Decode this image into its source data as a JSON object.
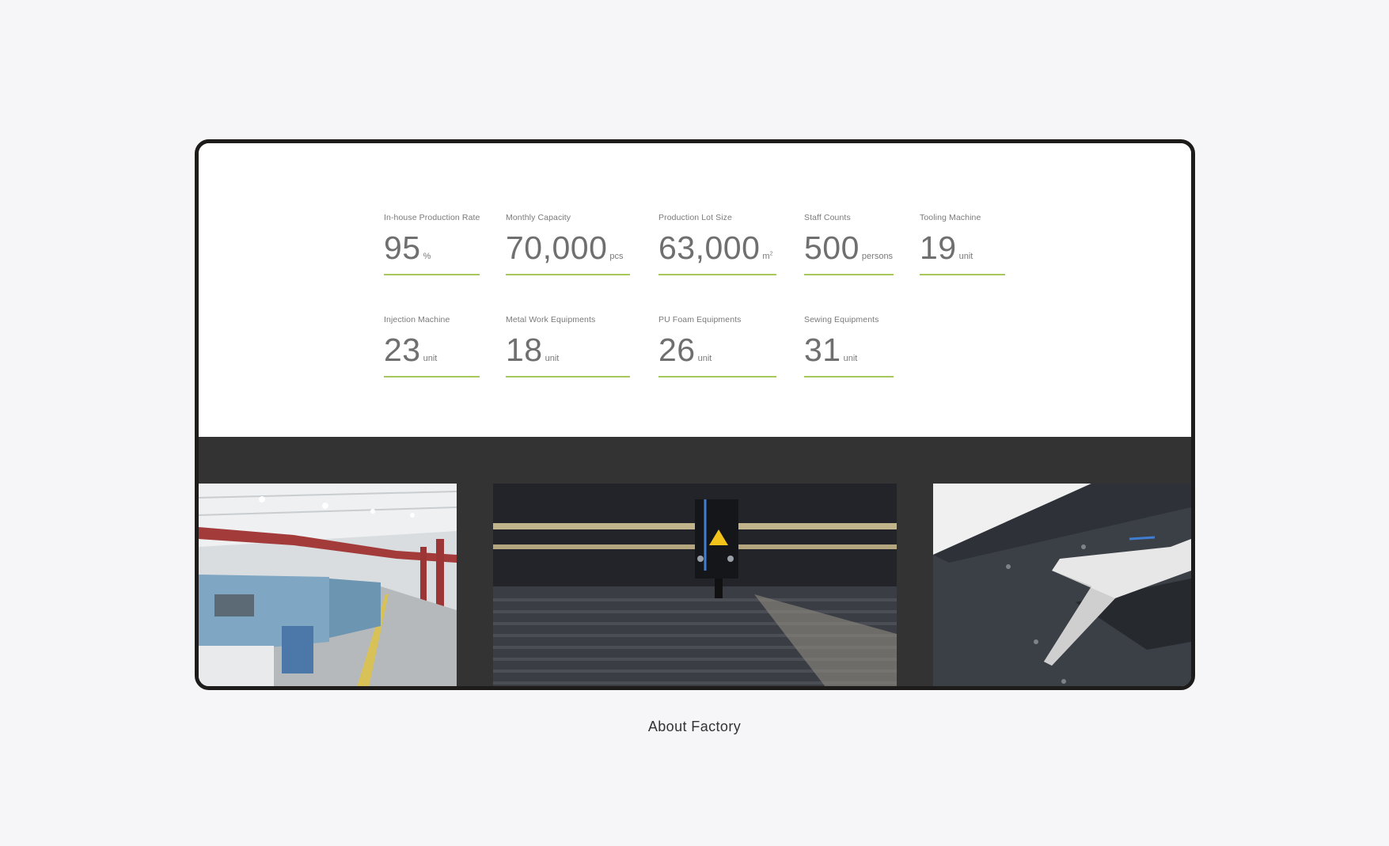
{
  "stats": [
    {
      "label": "In-house Production Rate",
      "value": "95",
      "unit": "%"
    },
    {
      "label": "Monthly Capacity",
      "value": "70,000",
      "unit": "pcs"
    },
    {
      "label": "Production Lot Size",
      "value": "63,000",
      "unit": "m",
      "unit_sup": "2"
    },
    {
      "label": "Staff Counts",
      "value": "500",
      "unit": "persons"
    },
    {
      "label": "Tooling Machine",
      "value": "19",
      "unit": "unit"
    },
    {
      "label": "Injection Machine",
      "value": "23",
      "unit": "unit"
    },
    {
      "label": "Metal Work Equipments",
      "value": "18",
      "unit": "unit"
    },
    {
      "label": "PU Foam Equipments",
      "value": "26",
      "unit": "unit"
    },
    {
      "label": "Sewing Equipments",
      "value": "31",
      "unit": "unit"
    }
  ],
  "caption": "About Factory",
  "colors": {
    "accent_underline": "#a7c85a",
    "frame_border": "#1e1b1b",
    "gallery_bg": "#333333",
    "page_bg": "#f6f6f8"
  }
}
